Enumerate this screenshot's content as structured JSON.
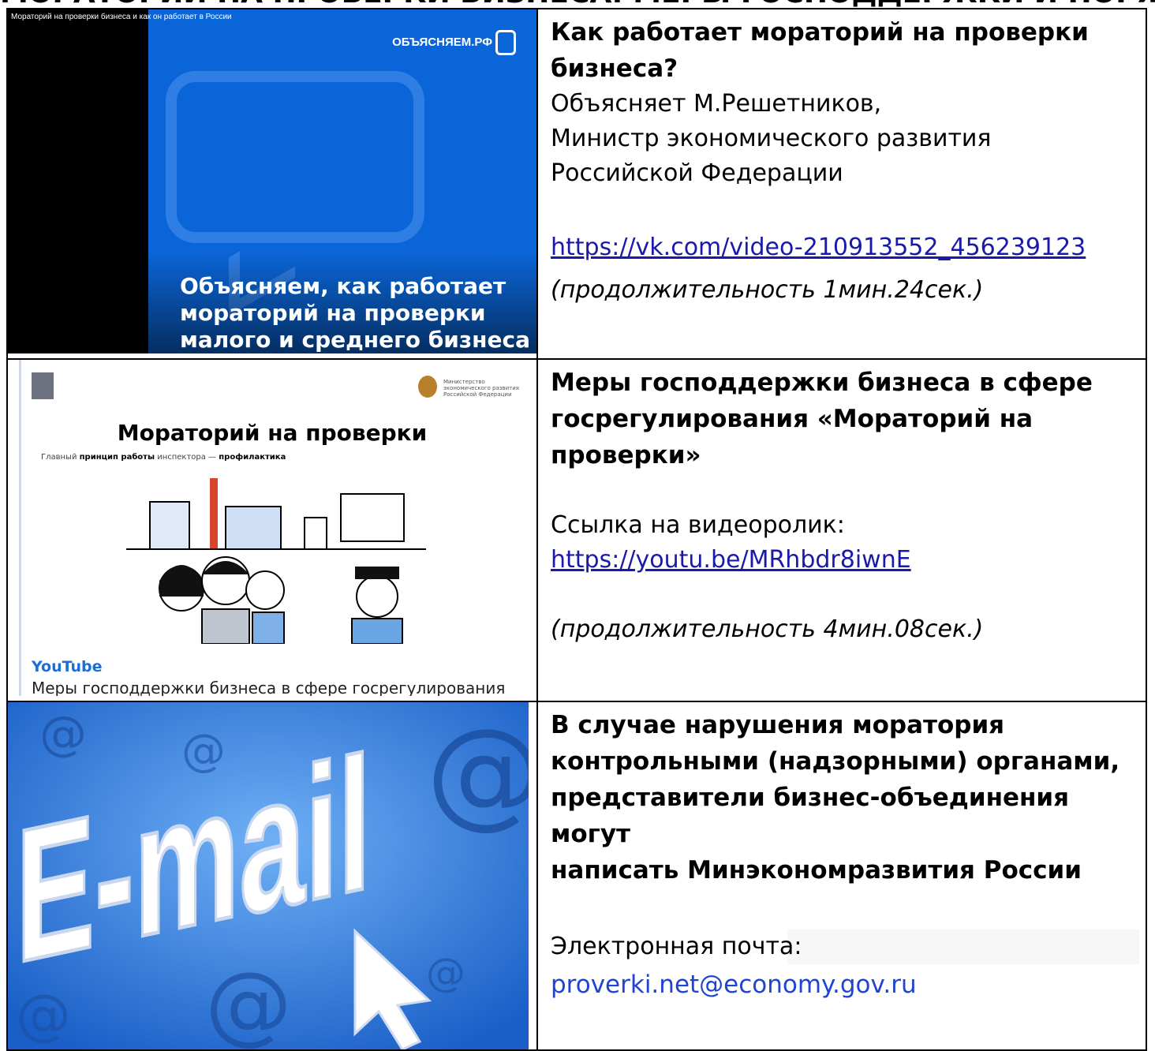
{
  "heading": {
    "text": "МОРАТОРИЙ НА ПРОВЕРКИ БИЗНЕСА: МЕРЫ ГОСПОДДЕРЖКИ И ПОРЯДОК ОБРАЩЕНИЙ"
  },
  "row1": {
    "thumb": {
      "video_title": "Мораторий на проверки бизнеса и как он работает в России",
      "logo": "ОБЪЯСНЯЕМ.РФ",
      "caption": [
        "Объясняем, как работает",
        "мораторий на проверки",
        "малого и среднего бизнеса"
      ]
    },
    "title_lines": [
      "Как работает мораторий на проверки",
      "бизнеса?"
    ],
    "lines": [
      "Объясняет М.Решетников,",
      "Министр экономического развития",
      "Российской Федерации"
    ],
    "link": "https://vk.com/video-210913552_456239123",
    "duration": "(продолжительность 1мин.24сек.)"
  },
  "row2": {
    "card": {
      "title": "Мораторий на проверки",
      "subtitle_pre": "Главный ",
      "subtitle_bold1": "принцип работы",
      "subtitle_mid": " инспектора — ",
      "subtitle_bold2": "профилактика",
      "ministry": "Министерство экономического развития Российской Федерации",
      "source": "YouTube",
      "desc": "Меры господдержки бизнеса в сфере госрегулирования"
    },
    "title_lines": [
      "Меры господдержки бизнеса в сфере",
      "госрегулирования «Мораторий на",
      "проверки»"
    ],
    "link_label": "Ссылка на видеоролик:",
    "link": "https://youtu.be/MRhbdr8iwnE",
    "duration": "(продолжительность 4мин.08сек.)"
  },
  "row3": {
    "title_lines": [
      "В случае нарушения моратория",
      "контрольными (надзорными) органами,",
      "представители бизнес-объединения могут",
      "написать Минэкономразвития России"
    ],
    "email_label": "Электронная почта:",
    "email": "proverki.net@economy.gov.ru",
    "image_text": "E-mail"
  }
}
